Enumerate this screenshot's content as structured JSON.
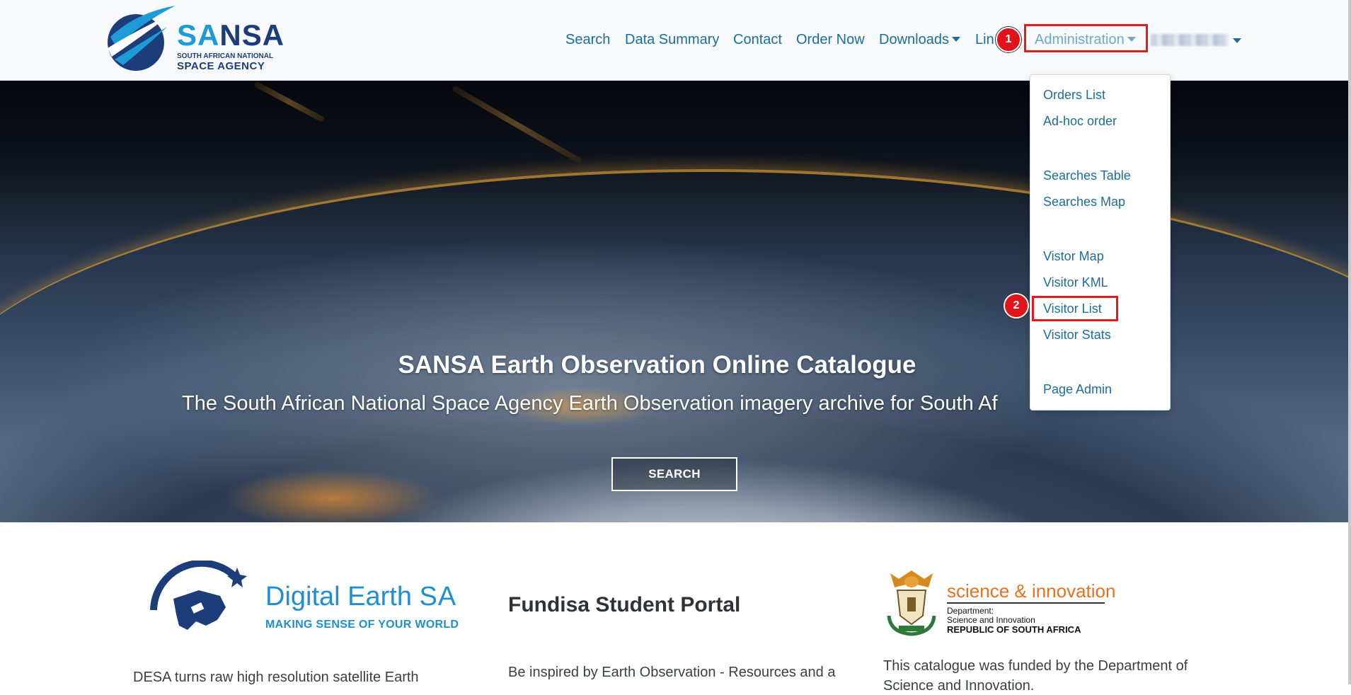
{
  "logo": {
    "name_part1": "SA",
    "name_part2": "NSA",
    "subtitle_small": "SOUTH AFRICAN NATIONAL",
    "subtitle_big": "SPACE AGENCY"
  },
  "nav": {
    "search": "Search",
    "data_summary": "Data Summary",
    "contact": "Contact",
    "order_now": "Order Now",
    "downloads": "Downloads",
    "links_truncated": "Lin",
    "administration": "Administration"
  },
  "markers": {
    "one": "1",
    "two": "2"
  },
  "admin_menu": {
    "items": [
      "Orders List",
      "Ad-hoc order",
      "Searches Table",
      "Searches Map",
      "Vistor Map",
      "Visitor KML",
      "Visitor List",
      "Visitor Stats",
      "Page Admin"
    ]
  },
  "hero": {
    "title": "SANSA Earth Observation Online Catalogue",
    "subtitle": "The South African National Space Agency Earth Observation imagery archive for South Af",
    "button": "SEARCH"
  },
  "columns": {
    "digital_earth": {
      "title_part1": "Digital Earth ",
      "title_part2": "SA",
      "tagline": "MAKING SENSE OF YOUR WORLD",
      "text": "DESA turns raw high resolution satellite Earth"
    },
    "fundisa": {
      "heading": "Fundisa Student Portal",
      "text": "Be inspired by Earth Observation - Resources and a"
    },
    "dsi": {
      "title": "science & innovation",
      "dept_line1": "Department:",
      "dept_line2": "Science and Innovation",
      "dept_line3": "REPUBLIC OF SOUTH AFRICA",
      "text_line1": "This catalogue was funded by the Department of",
      "text_line2": "Science and Innovation."
    }
  },
  "colors": {
    "nav_link": "#1b6e9c",
    "highlight_box": "#e11c1c",
    "brand_dark": "#1d3d7a",
    "brand_light": "#1e9ad6",
    "dsi_orange": "#e8701e"
  }
}
